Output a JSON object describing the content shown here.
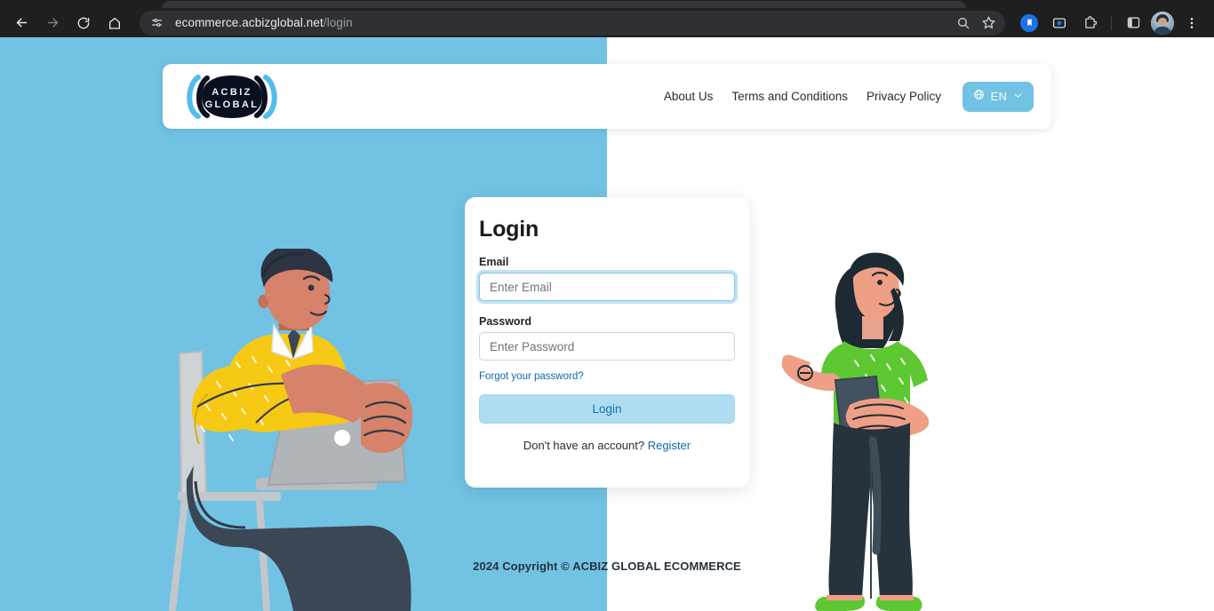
{
  "browser": {
    "url_domain": "ecommerce.acbizglobal.net",
    "url_path": "/login",
    "back_icon": "back-arrow-icon",
    "forward_icon": "forward-arrow-icon",
    "reload_icon": "reload-icon",
    "home_icon": "home-icon",
    "site_info_icon": "site-settings-icon",
    "search_icon": "search-icon",
    "bookmark_icon": "star-icon",
    "extension_icons": [
      "bookmark-badge-icon",
      "screen-recorder-icon",
      "extensions-puzzle-icon"
    ],
    "side_panel_icon": "side-panel-icon",
    "profile_icon": "profile-avatar-icon",
    "menu_icon": "three-dot-menu-icon"
  },
  "header": {
    "logo_line1": "ACBIZ",
    "logo_line2": "GLOBAL",
    "nav_links": [
      {
        "label": "About Us",
        "name": "nav-link-about-us"
      },
      {
        "label": "Terms and Conditions",
        "name": "nav-link-terms"
      },
      {
        "label": "Privacy Policy",
        "name": "nav-link-privacy"
      }
    ],
    "language": {
      "code": "EN",
      "globe_icon": "globe-icon",
      "chevron_icon": "chevron-down-icon"
    }
  },
  "login": {
    "title": "Login",
    "email_label": "Email",
    "email_value": "",
    "email_placeholder": "Enter Email",
    "password_label": "Password",
    "password_value": "",
    "password_placeholder": "Enter Password",
    "forgot_password": "Forgot your password?",
    "submit_label": "Login",
    "register_prompt": "Don't have an account?",
    "register_label": "Register"
  },
  "footer": {
    "copyright": "2024 Copyright © ACBIZ GLOBAL ECOMMERCE"
  },
  "colors": {
    "brand_blue": "#72c2e4",
    "button_blue": "#aedcf0",
    "link_blue": "#0d6aaa",
    "page_white": "#ffffff"
  },
  "illustrations": {
    "left": "man-with-laptop-illustration",
    "right": "woman-pointing-illustration"
  }
}
